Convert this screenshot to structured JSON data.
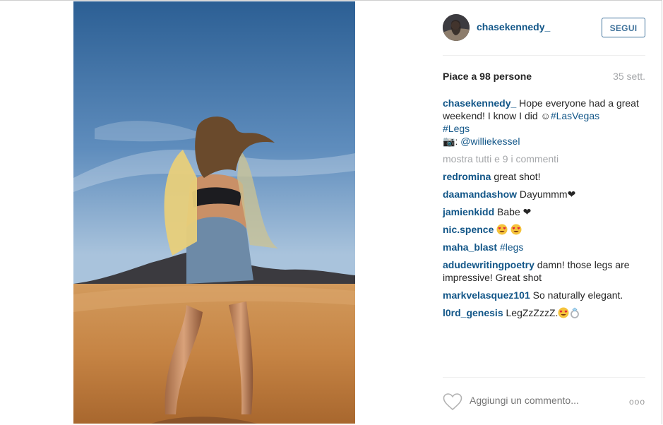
{
  "header": {
    "username": "chasekennedy_",
    "follow_label": "SEGUI"
  },
  "meta": {
    "likes": "Piace a 98 persone",
    "time": "35 sett."
  },
  "caption": {
    "user": "chasekennedy_",
    "text": " Hope everyone had a great weekend! I know I did ",
    "emoji": "☺",
    "tag1": "#LasVegas",
    "tag2": "#Legs",
    "camera": "📷",
    "credit_sep": ": ",
    "credit": "@williekessel"
  },
  "more_comments": "mostra tutti e 9 i commenti",
  "comments": [
    {
      "user": "redromina",
      "text": "great shot!"
    },
    {
      "user": "daamandashow",
      "text": "Dayummm❤"
    },
    {
      "user": "jamienkidd",
      "text": "Babe ❤"
    },
    {
      "user": "nic.spence",
      "text": ""
    },
    {
      "user": "maha_blast",
      "text": "#legs"
    },
    {
      "user": "adudewritingpoetry",
      "text": "damn! those legs are impressive! Great shot"
    },
    {
      "user": "markvelasquez101",
      "text": "So naturally elegant."
    },
    {
      "user": "l0rd_genesis",
      "text": "LegZzZzzZ."
    }
  ],
  "footer": {
    "add_comment_placeholder": "Aggiungi un commento...",
    "options": "ooo"
  },
  "icons": {
    "heart": "heart-icon",
    "options": "more-options-icon",
    "heart_eyes": "heart-eyes-emoji",
    "ring": "ring-emoji"
  }
}
